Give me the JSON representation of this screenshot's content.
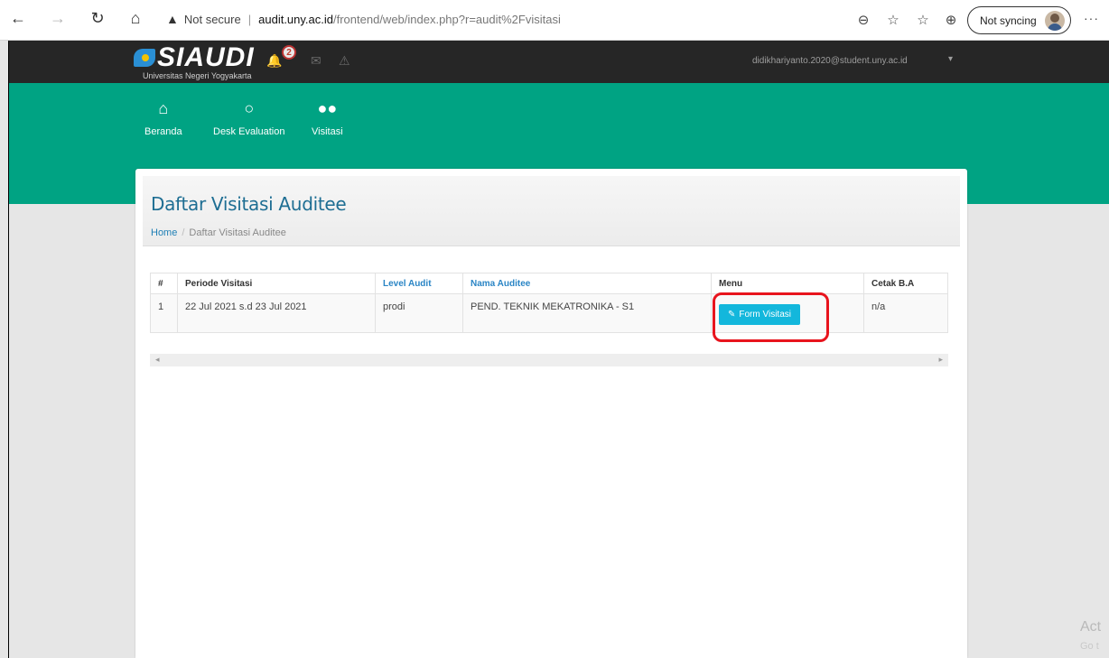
{
  "browser": {
    "security_label": "Not secure",
    "url_host": "audit.uny.ac.id",
    "url_path": "/frontend/web/index.php?r=audit%2Fvisitasi",
    "sync_label": "Not syncing",
    "more_label": "···"
  },
  "topbar": {
    "logo_text": "SIAUDI",
    "logo_subtitle": "Universitas Negeri Yogyakarta",
    "notification_count": "2",
    "user_email": "didikhariyanto.2020@student.uny.ac.id"
  },
  "menu": [
    {
      "label": "Beranda",
      "icon": "home-icon"
    },
    {
      "label": "Desk Evaluation",
      "icon": "chat-icon"
    },
    {
      "label": "Visitasi",
      "icon": "users-icon"
    }
  ],
  "page": {
    "title": "Daftar Visitasi Auditee",
    "breadcrumb_home": "Home",
    "breadcrumb_current": "Daftar Visitasi Auditee"
  },
  "table": {
    "headers": [
      "#",
      "Periode Visitasi",
      "Level Audit",
      "Nama Auditee",
      "Menu",
      "Cetak B.A"
    ],
    "rows": [
      {
        "no": "1",
        "periode": "22 Jul 2021 s.d 23 Jul 2021",
        "level": "prodi",
        "nama": "PEND. TEKNIK MEKATRONIKA - S1",
        "menu_button": "Form Visitasi",
        "cetak": "n/a"
      }
    ]
  },
  "watermark": {
    "line1": "Act",
    "line2": "Go t"
  },
  "colors": {
    "topbar": "#262626",
    "green": "#00a383",
    "title": "#1e6e93",
    "button": "#13b7dc",
    "highlight": "#e8141d"
  }
}
